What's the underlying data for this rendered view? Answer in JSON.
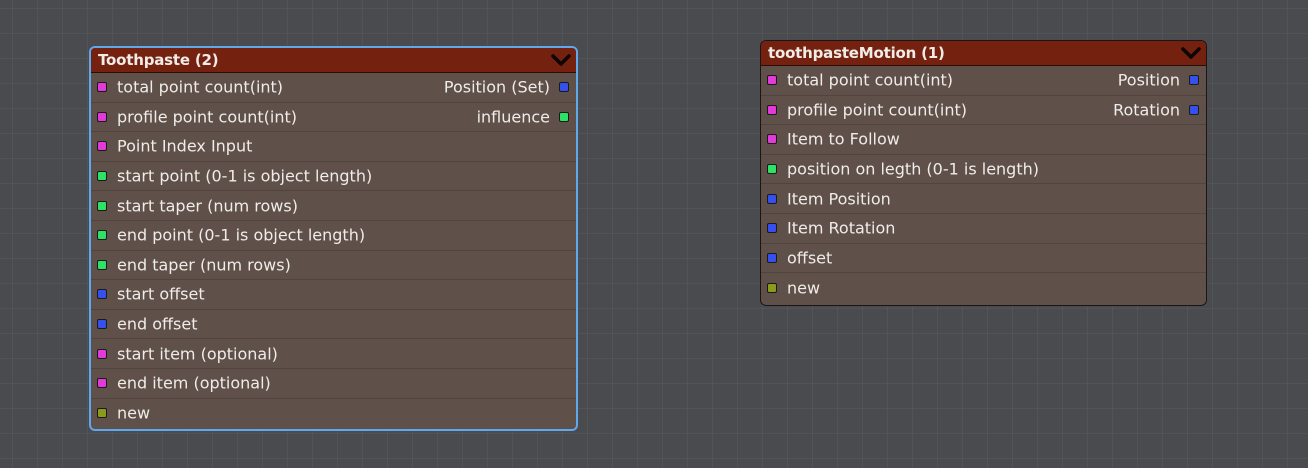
{
  "colors": {
    "magenta": "#e13ad8",
    "green": "#2ee266",
    "blue": "#3550ec",
    "olive": "#8c9a1c",
    "header": "#74220f",
    "body": "#5f5049",
    "selection": "#5ea8ee"
  },
  "nodes": [
    {
      "title": "Toothpaste (2)",
      "selected": true,
      "rows": [
        {
          "in": {
            "label": "total point count(int)",
            "color": "#e13ad8"
          },
          "out": {
            "label": "Position (Set)",
            "color": "#3550ec"
          }
        },
        {
          "in": {
            "label": "profile point count(int)",
            "color": "#e13ad8"
          },
          "out": {
            "label": "influence",
            "color": "#2ee266"
          }
        },
        {
          "in": {
            "label": "Point Index Input",
            "color": "#e13ad8"
          }
        },
        {
          "in": {
            "label": "start point (0-1 is object length)",
            "color": "#2ee266"
          }
        },
        {
          "in": {
            "label": "start taper (num rows)",
            "color": "#2ee266"
          }
        },
        {
          "in": {
            "label": "end point (0-1 is object length)",
            "color": "#2ee266"
          }
        },
        {
          "in": {
            "label": "end taper (num rows)",
            "color": "#2ee266"
          }
        },
        {
          "in": {
            "label": "start offset",
            "color": "#3550ec"
          }
        },
        {
          "in": {
            "label": "end offset",
            "color": "#3550ec"
          }
        },
        {
          "in": {
            "label": "start item (optional)",
            "color": "#e13ad8"
          }
        },
        {
          "in": {
            "label": "end item (optional)",
            "color": "#e13ad8"
          }
        },
        {
          "in": {
            "label": "new",
            "color": "#8c9a1c"
          }
        }
      ]
    },
    {
      "title": "toothpasteMotion (1)",
      "selected": false,
      "rows": [
        {
          "in": {
            "label": "total point count(int)",
            "color": "#e13ad8"
          },
          "out": {
            "label": "Position",
            "color": "#3550ec"
          }
        },
        {
          "in": {
            "label": "profile point count(int)",
            "color": "#e13ad8"
          },
          "out": {
            "label": "Rotation",
            "color": "#3550ec"
          }
        },
        {
          "in": {
            "label": "Item to Follow",
            "color": "#e13ad8"
          }
        },
        {
          "in": {
            "label": "position on legth (0-1 is length)",
            "color": "#2ee266"
          }
        },
        {
          "in": {
            "label": "Item Position",
            "color": "#3550ec"
          }
        },
        {
          "in": {
            "label": "Item Rotation",
            "color": "#3550ec"
          }
        },
        {
          "in": {
            "label": "offset",
            "color": "#3550ec"
          }
        },
        {
          "in": {
            "label": "new",
            "color": "#8c9a1c"
          }
        }
      ]
    }
  ]
}
